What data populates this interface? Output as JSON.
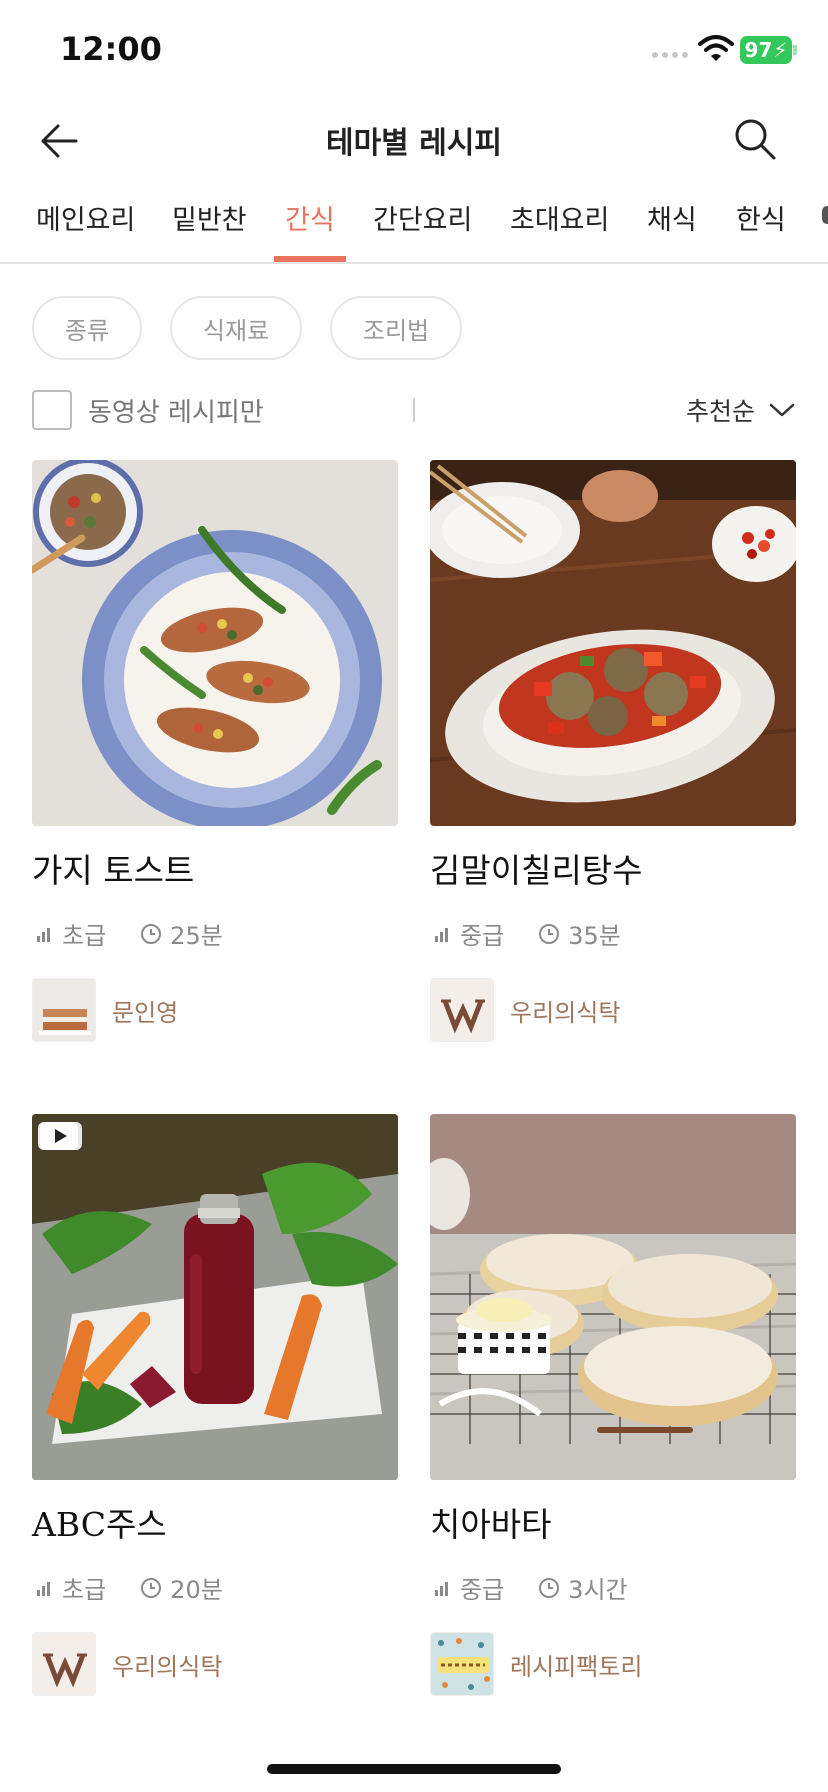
{
  "status_bar": {
    "time": "12:00",
    "battery": "97"
  },
  "header": {
    "title": "테마별 레시피"
  },
  "tabs": [
    {
      "label": "메인요리",
      "active": false
    },
    {
      "label": "밑반찬",
      "active": false
    },
    {
      "label": "간식",
      "active": true
    },
    {
      "label": "간단요리",
      "active": false
    },
    {
      "label": "초대요리",
      "active": false
    },
    {
      "label": "채식",
      "active": false
    },
    {
      "label": "한식",
      "active": false
    }
  ],
  "filters": {
    "chips": [
      "종류",
      "식재료",
      "조리법"
    ]
  },
  "video_only": {
    "label": "동영상 레시피만",
    "checked": false
  },
  "sort": {
    "label": "추천순"
  },
  "recipes": [
    {
      "title": "가지 토스트",
      "level": "초급",
      "time": "25분",
      "author": "문인영",
      "has_video": false
    },
    {
      "title": "김말이칠리탕수",
      "level": "중급",
      "time": "35분",
      "author": "우리의식탁",
      "has_video": false
    },
    {
      "title": "ABC주스",
      "level": "초급",
      "time": "20분",
      "author": "우리의식탁",
      "has_video": true
    },
    {
      "title": "치아바타",
      "level": "중급",
      "time": "3시간",
      "author": "레시피팩토리",
      "has_video": false
    }
  ],
  "colors": {
    "accent": "#e8735f",
    "author": "#a0775c",
    "battery": "#34c759"
  }
}
